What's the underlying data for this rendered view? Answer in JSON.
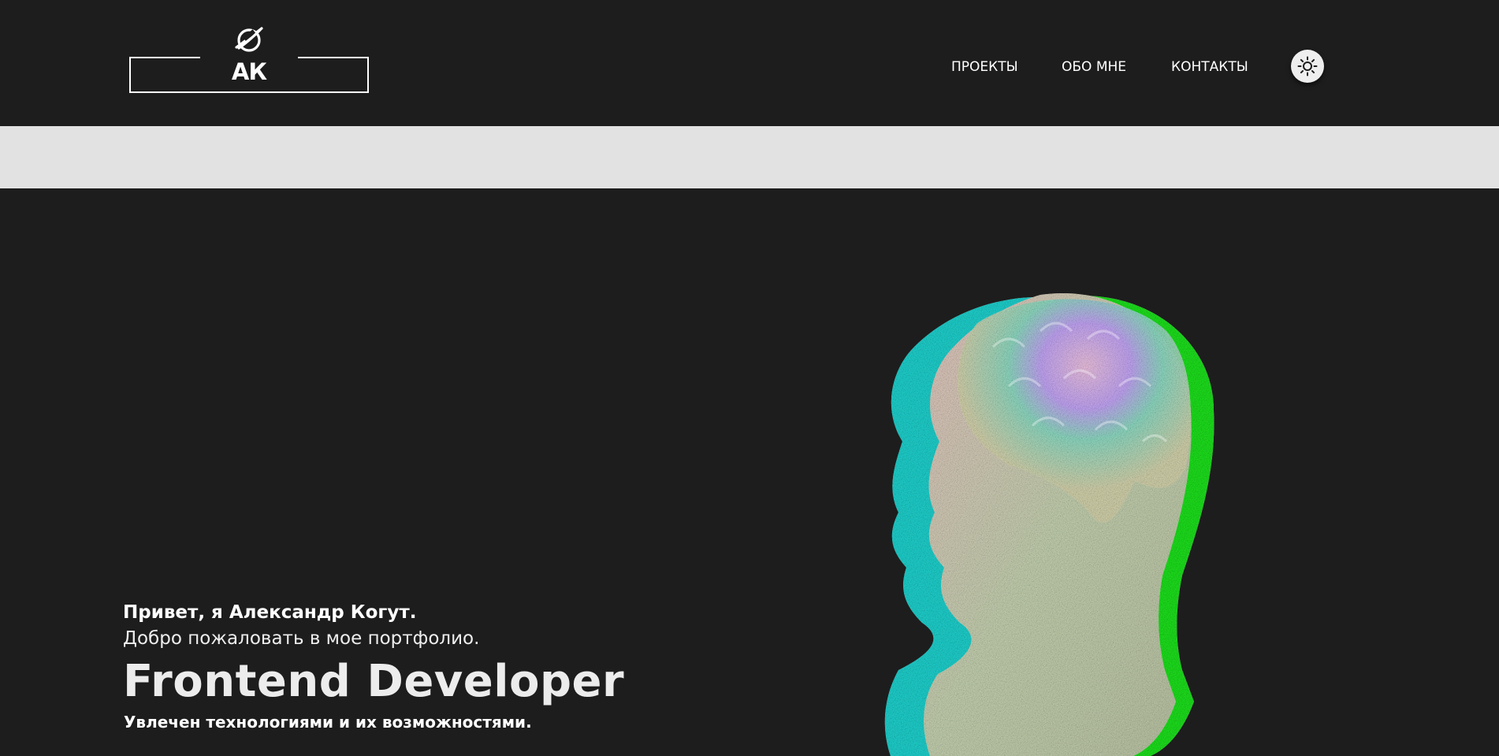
{
  "logo": {
    "text": "АК",
    "icon": "planet-icon"
  },
  "nav": {
    "projects": "ПРОЕКТЫ",
    "about": "ОБО МНЕ",
    "contacts": "КОНТАКТЫ"
  },
  "theme_toggle": {
    "icon": "sun-icon"
  },
  "hero": {
    "greeting": "Привет, я Александр Когут.",
    "welcome": "Добро пожаловать в мое портфолио.",
    "role": "Frontend Developer",
    "tagline": "Увлечен технологиями и их возможностями."
  },
  "colors": {
    "background": "#1d1d1d",
    "strip": "#e2e2e2",
    "text": "#ffffff",
    "bust_cyan": "#1fd6d2",
    "bust_green": "#1ee61e"
  }
}
